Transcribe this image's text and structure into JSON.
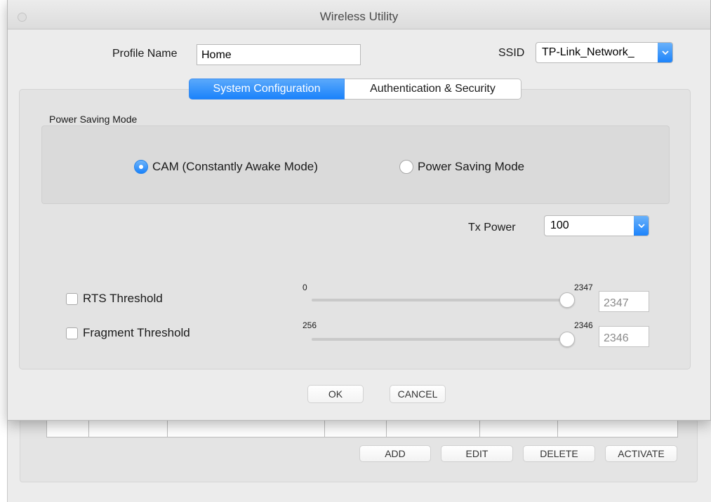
{
  "window": {
    "title": "Wireless Utility"
  },
  "profile": {
    "label": "Profile Name",
    "value": "Home"
  },
  "ssid": {
    "label": "SSID",
    "value": "TP-Link_Network_"
  },
  "tabs": [
    {
      "label": "System Configuration",
      "active": true
    },
    {
      "label": "Authentication & Security",
      "active": false
    }
  ],
  "power_saving": {
    "caption": "Power Saving Mode",
    "options": [
      {
        "label": "CAM (Constantly Awake Mode)",
        "selected": true
      },
      {
        "label": "Power Saving Mode",
        "selected": false
      }
    ]
  },
  "tx_power": {
    "label": "Tx Power",
    "value": "100"
  },
  "rts": {
    "label": "RTS Threshold",
    "checked": false,
    "min": "0",
    "max": "2347",
    "value": "2347"
  },
  "fragment": {
    "label": "Fragment Threshold",
    "checked": false,
    "min": "256",
    "max": "2346",
    "value": "2346"
  },
  "dialog_buttons": {
    "ok": "OK",
    "cancel": "CANCEL"
  },
  "profile_list_buttons": {
    "add": "ADD",
    "edit": "EDIT",
    "delete": "DELETE",
    "activate": "ACTIVATE"
  },
  "colors": {
    "accent": "#1a82fb",
    "panel": "#e3e3e3",
    "window": "#ececec"
  }
}
